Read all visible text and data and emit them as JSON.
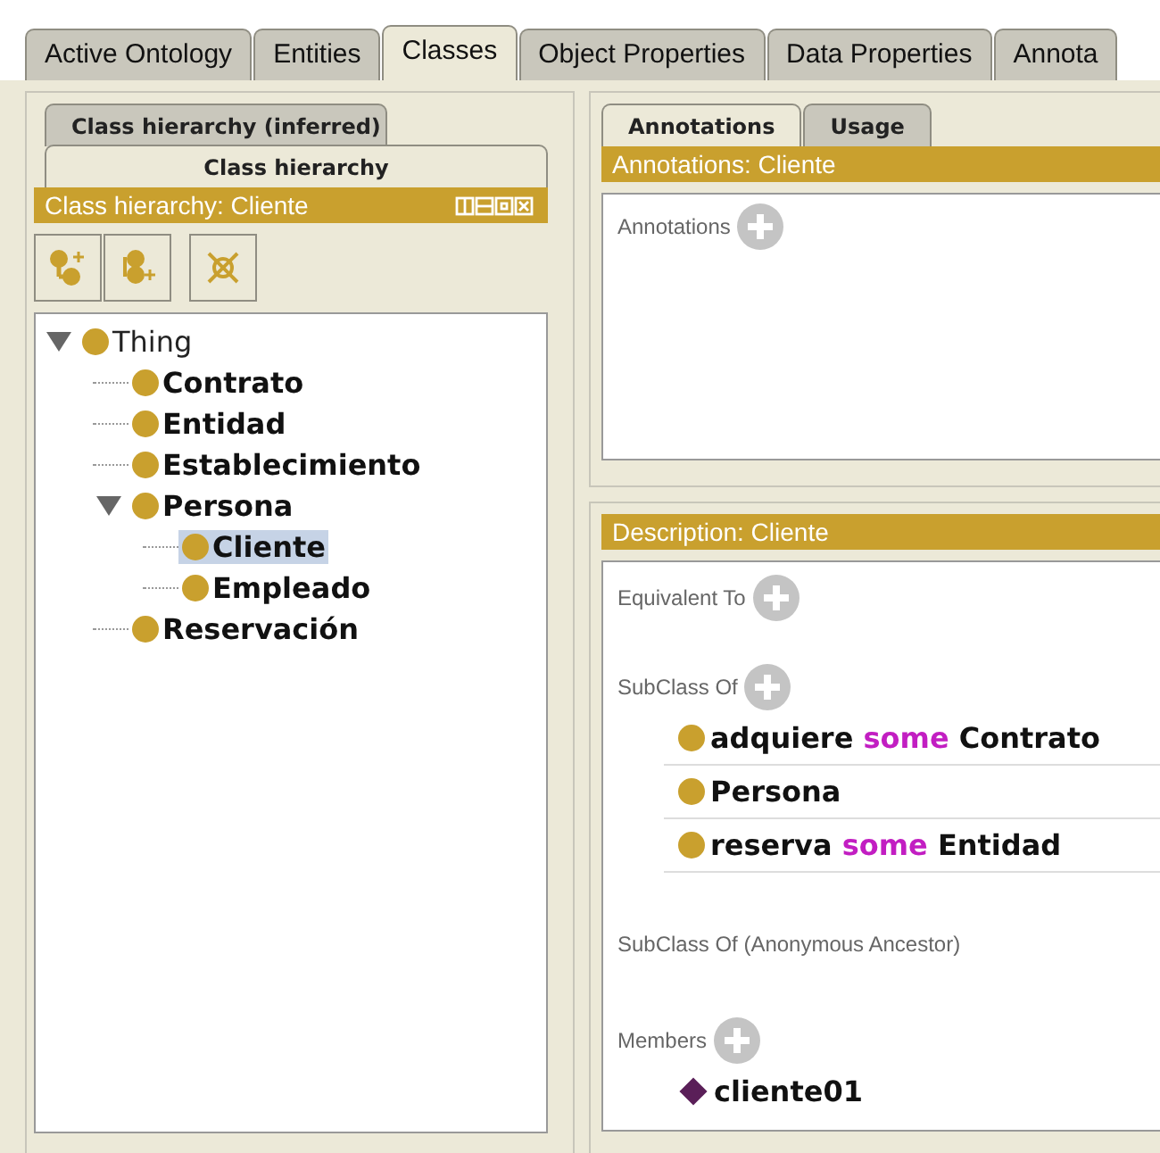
{
  "main_tabs": [
    {
      "label": "Active Ontology",
      "selected": false
    },
    {
      "label": "Entities",
      "selected": false
    },
    {
      "label": "Classes",
      "selected": true
    },
    {
      "label": "Object Properties",
      "selected": false
    },
    {
      "label": "Data Properties",
      "selected": false
    },
    {
      "label": "Annota",
      "selected": false
    }
  ],
  "left_panel": {
    "view_tabs": [
      {
        "label": "Class hierarchy (inferred)",
        "selected": false
      },
      {
        "label": "Class hierarchy",
        "selected": true
      }
    ],
    "header": {
      "title": "Class hierarchy: Cliente"
    },
    "tree": [
      {
        "label": "Thing",
        "expanded": true,
        "selected": false,
        "bold": false,
        "children": [
          {
            "label": "Contrato",
            "selected": false,
            "bold": true
          },
          {
            "label": "Entidad",
            "selected": false,
            "bold": true
          },
          {
            "label": "Establecimiento",
            "selected": false,
            "bold": true
          },
          {
            "label": "Persona",
            "expanded": true,
            "selected": false,
            "bold": true,
            "children": [
              {
                "label": "Cliente",
                "selected": true,
                "bold": true
              },
              {
                "label": "Empleado",
                "selected": false,
                "bold": true
              }
            ]
          },
          {
            "label": "Reservación",
            "selected": false,
            "bold": true
          }
        ]
      }
    ]
  },
  "annotations_panel": {
    "view_tabs": [
      {
        "label": "Annotations",
        "selected": true
      },
      {
        "label": "Usage",
        "selected": false
      }
    ],
    "header": {
      "title": "Annotations: Cliente"
    },
    "sections": [
      {
        "title": "Annotations",
        "add": true
      }
    ]
  },
  "description_panel": {
    "header": {
      "title": "Description: Cliente"
    },
    "sections": [
      {
        "title": "Equivalent To",
        "add": true
      },
      {
        "title": "SubClass Of",
        "add": true,
        "items": [
          {
            "kind": "class",
            "parts": [
              {
                "text": "adquiere",
                "keyword": false
              },
              {
                "text": "some",
                "keyword": true
              },
              {
                "text": "Contrato",
                "keyword": false
              }
            ]
          },
          {
            "kind": "class",
            "parts": [
              {
                "text": "Persona",
                "keyword": false
              }
            ]
          },
          {
            "kind": "class",
            "parts": [
              {
                "text": "reserva",
                "keyword": false
              },
              {
                "text": "some",
                "keyword": true
              },
              {
                "text": "Entidad",
                "keyword": false
              }
            ]
          }
        ]
      },
      {
        "title": "SubClass Of (Anonymous Ancestor)",
        "add": false
      },
      {
        "title": "Members",
        "add": true,
        "items": [
          {
            "kind": "individual",
            "parts": [
              {
                "text": "cliente01",
                "keyword": false
              }
            ]
          }
        ]
      }
    ]
  }
}
